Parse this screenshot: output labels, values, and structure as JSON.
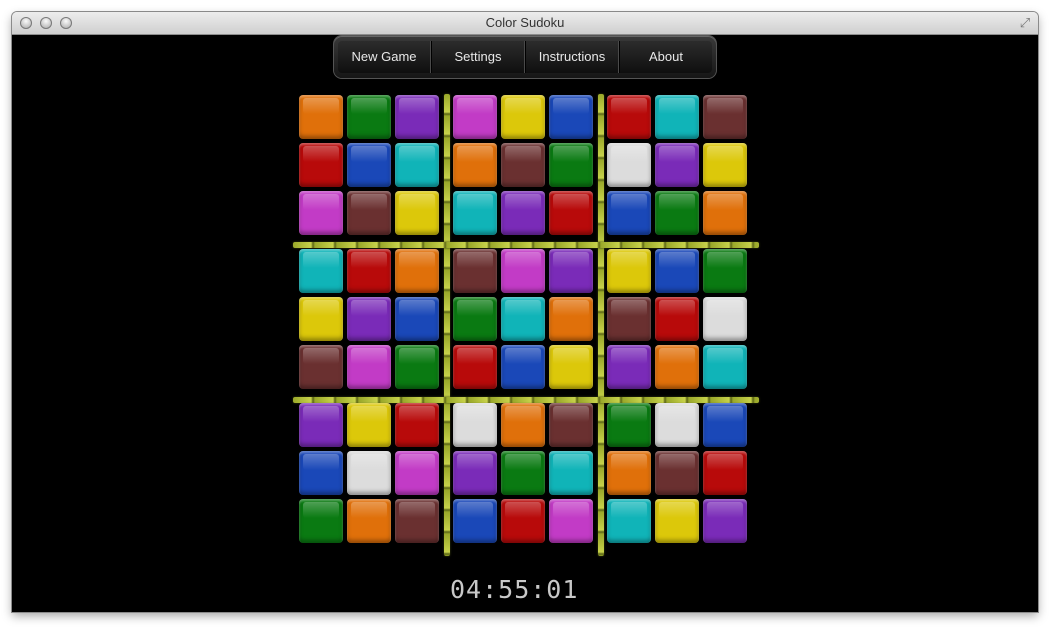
{
  "window": {
    "title": "Color Sudoku"
  },
  "menu": {
    "new_game": "New Game",
    "settings": "Settings",
    "instructions": "Instructions",
    "about": "About"
  },
  "palette": {
    "orange": "#e0700a",
    "green": "#0a7a12",
    "purple": "#7a2bb8",
    "magenta": "#c23bc6",
    "yellow": "#dcc80a",
    "blue": "#1a48b8",
    "red": "#b80a0a",
    "teal": "#10b4b8",
    "brown": "#6a3030",
    "white": "#dcdcdc"
  },
  "grid": [
    [
      "orange",
      "green",
      "purple",
      "magenta",
      "yellow",
      "blue",
      "red",
      "teal",
      "brown"
    ],
    [
      "red",
      "blue",
      "teal",
      "orange",
      "brown",
      "green",
      "white",
      "purple",
      "yellow"
    ],
    [
      "magenta",
      "brown",
      "yellow",
      "teal",
      "purple",
      "red",
      "blue",
      "green",
      "orange"
    ],
    [
      "teal",
      "red",
      "orange",
      "brown",
      "magenta",
      "purple",
      "yellow",
      "blue",
      "green"
    ],
    [
      "yellow",
      "purple",
      "blue",
      "green",
      "teal",
      "orange",
      "brown",
      "red",
      "white"
    ],
    [
      "brown",
      "magenta",
      "green",
      "red",
      "blue",
      "yellow",
      "purple",
      "orange",
      "teal"
    ],
    [
      "purple",
      "yellow",
      "red",
      "white",
      "orange",
      "brown",
      "green",
      "white",
      "blue"
    ],
    [
      "blue",
      "white",
      "magenta",
      "purple",
      "green",
      "teal",
      "orange",
      "brown",
      "red"
    ],
    [
      "green",
      "orange",
      "brown",
      "blue",
      "red",
      "magenta",
      "teal",
      "yellow",
      "purple"
    ]
  ],
  "timer": "04:55:01"
}
